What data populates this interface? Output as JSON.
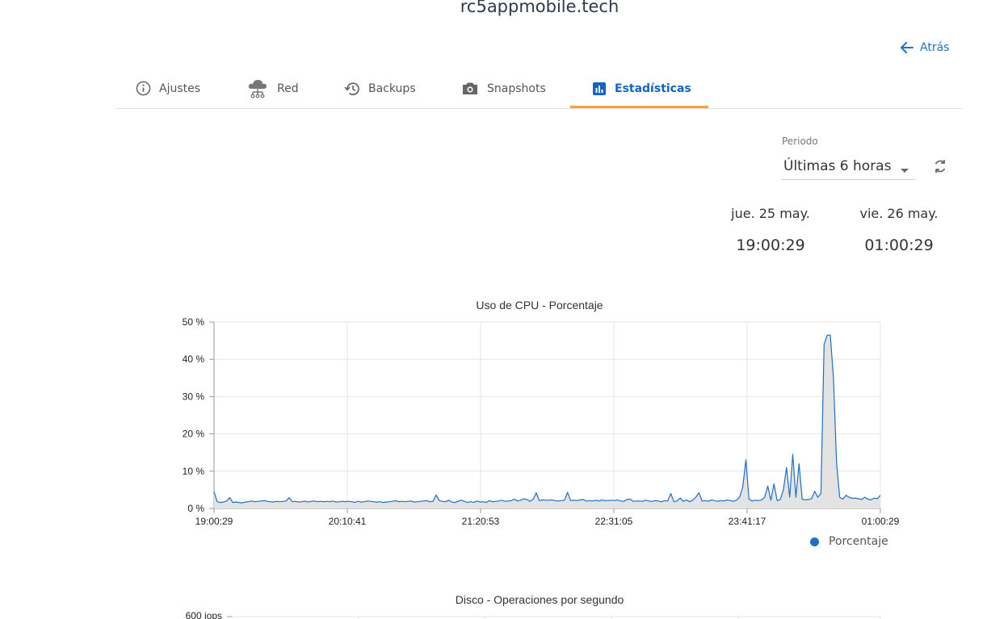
{
  "header": {
    "title": "rc5appmobile.tech",
    "back_label": "Atrás"
  },
  "tabs": [
    {
      "label": "Ajustes",
      "icon": "info-icon"
    },
    {
      "label": "Red",
      "icon": "cloud-network-icon"
    },
    {
      "label": "Backups",
      "icon": "history-icon"
    },
    {
      "label": "Snapshots",
      "icon": "camera-icon"
    },
    {
      "label": "Estadísticas",
      "icon": "bar-chart-icon",
      "active": true
    }
  ],
  "period": {
    "label": "Periodo",
    "value": "Últimas 6 horas"
  },
  "range": {
    "start_date": "jue. 25 may.",
    "start_time": "19:00:29",
    "end_date": "vie. 26 may.",
    "end_time": "01:00:29"
  },
  "colors": {
    "accent": "#1565c0",
    "tab_underline": "#f3a33a",
    "series": "#1f6fc5",
    "fill": "#e3e3e3"
  },
  "chart_data": [
    {
      "type": "area",
      "title": "Uso de CPU - Porcentaje",
      "x_ticks": [
        "19:00:29",
        "20:10:41",
        "21:20:53",
        "22:31:05",
        "23:41:17",
        "01:00:29"
      ],
      "y_ticks": [
        "0 %",
        "10 %",
        "20 %",
        "30 %",
        "40 %",
        "50 %"
      ],
      "ylim": [
        0,
        50
      ],
      "grid": true,
      "legend_position": "bottom-right",
      "series": [
        {
          "name": "Porcentaje",
          "values": [
            4.5,
            1.8,
            1.6,
            1.7,
            2.0,
            2.9,
            1.6,
            1.7,
            1.6,
            1.5,
            1.7,
            1.8,
            2.0,
            1.8,
            1.9,
            2.0,
            2.1,
            1.9,
            1.8,
            1.7,
            1.9,
            1.8,
            1.9,
            2.0,
            2.9,
            1.8,
            1.9,
            1.7,
            1.8,
            2.0,
            1.7,
            1.9,
            2.0,
            1.8,
            1.9,
            1.8,
            1.9,
            1.8,
            2.0,
            1.7,
            1.8,
            1.9,
            1.8,
            1.9,
            1.8,
            1.6,
            1.9,
            1.7,
            1.8,
            2.0,
            1.9,
            1.8,
            1.7,
            1.8,
            1.6,
            1.7,
            1.8,
            1.9,
            2.1,
            1.8,
            1.9,
            1.8,
            1.9,
            2.0,
            1.7,
            1.8,
            1.9,
            2.0,
            2.1,
            1.8,
            1.9,
            3.6,
            2.1,
            1.9,
            1.8,
            2.2,
            1.7,
            1.6,
            1.9,
            2.2,
            1.9,
            1.6,
            1.8,
            1.6,
            2.0,
            1.7,
            1.8,
            1.6,
            2.1,
            1.8,
            1.9,
            2.0,
            2.2,
            1.9,
            2.0,
            2.1,
            2.5,
            2.0,
            2.2,
            2.6,
            2.4,
            1.9,
            2.5,
            4.2,
            2.1,
            2.3,
            2.2,
            2.2,
            2.3,
            2.1,
            2.0,
            2.1,
            2.2,
            4.3,
            2.1,
            2.2,
            2.1,
            2.3,
            2.4,
            2.0,
            2.1,
            2.0,
            2.2,
            2.0,
            2.3,
            2.1,
            2.1,
            2.2,
            2.1,
            2.3,
            2.0,
            1.9,
            2.4,
            2.5,
            1.9,
            2.0,
            2.0,
            1.9,
            2.2,
            2.0,
            1.9,
            2.1,
            2.0,
            1.8,
            2.1,
            2.0,
            4.0,
            1.8,
            2.0,
            2.8,
            1.9,
            2.3,
            1.8,
            2.2,
            3.0,
            4.2,
            2.0,
            2.1,
            1.9,
            2.3,
            2.1,
            1.9,
            2.1,
            2.0,
            2.3,
            2.1,
            1.9,
            2.2,
            3.0,
            5.8,
            13.0,
            2.5,
            2.0,
            2.2,
            2.1,
            2.3,
            3.0,
            6.0,
            2.2,
            6.6,
            2.1,
            2.4,
            5.0,
            11.0,
            3.0,
            14.5,
            3.0,
            12.0,
            2.5,
            2.3,
            2.4,
            2.6,
            4.6,
            3.0,
            4.0,
            44.0,
            46.5,
            46.5,
            35.0,
            12.0,
            3.0,
            2.5,
            3.5,
            3.0,
            2.7,
            2.8,
            2.6,
            2.4,
            3.0,
            2.5,
            2.3,
            2.8,
            2.6,
            3.5
          ]
        }
      ]
    },
    {
      "type": "line",
      "title": "Disco - Operaciones por segundo",
      "y_ticks": [
        "600 iops"
      ],
      "grid": true
    }
  ]
}
